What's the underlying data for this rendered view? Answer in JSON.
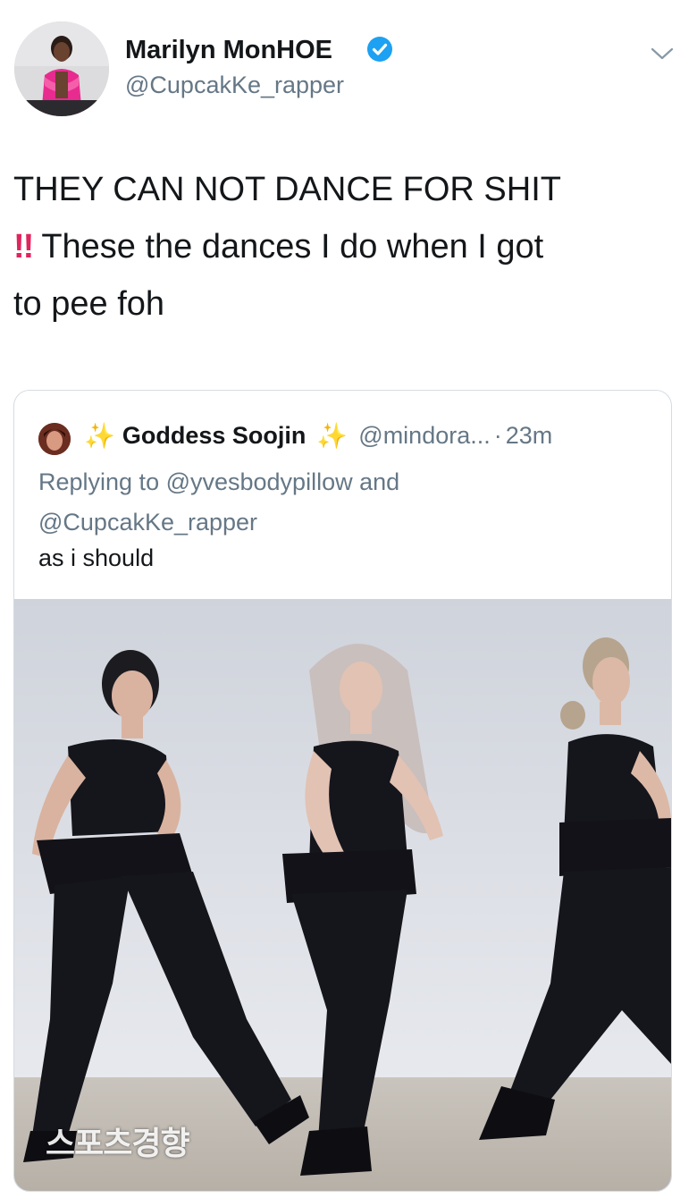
{
  "tweet": {
    "author_name": "Marilyn MonHOE",
    "author_handle": "@CupcakKe_rapper",
    "verified": true,
    "text_lines": [
      "THEY CAN NOT DANCE FOR SHIT",
      "These the dances I do when I got",
      "to pee foh"
    ],
    "emoji": "!!",
    "icons": {
      "verified": "verified-badge-icon",
      "caret": "chevron-down-icon"
    }
  },
  "quote": {
    "author_name": "Goddess Soojin",
    "sparkle": "✨",
    "handle": "@mindora...",
    "separator": "·",
    "time": "23m",
    "replying_lines": [
      "Replying to @yvesbodypillow and",
      "@CupcakKe_rapper"
    ],
    "text": "as i should",
    "media_watermark": "스포츠경향"
  },
  "colors": {
    "primary_text": "#14171a",
    "secondary_text": "#657786",
    "verified_blue": "#1da1f2",
    "emoji_red": "#e0245e",
    "card_border": "#d5dce2"
  }
}
